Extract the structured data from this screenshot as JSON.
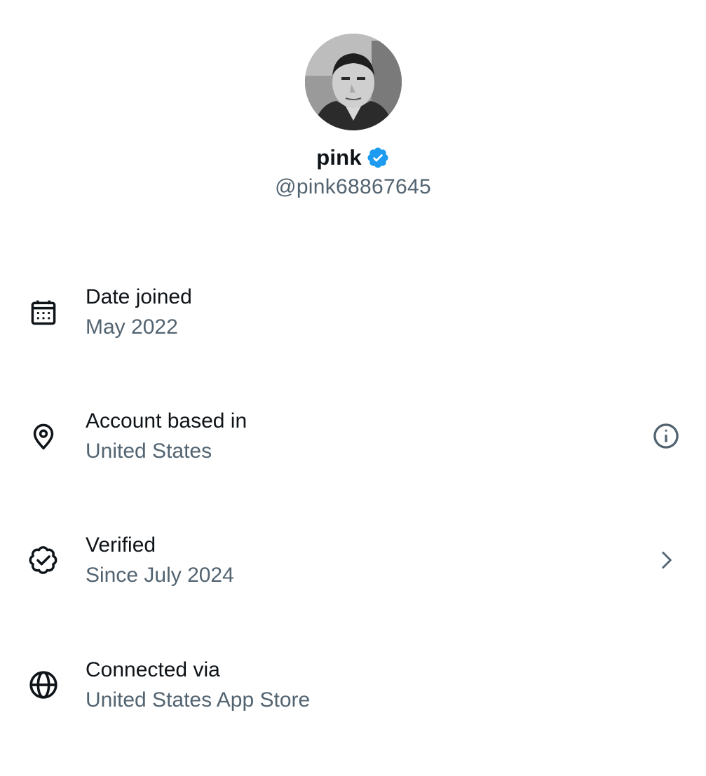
{
  "profile": {
    "display_name": "pink",
    "handle": "@pink68867645",
    "verified": true,
    "badge_color": "#1d9bf0",
    "avatar_icon": "profile-photo"
  },
  "info_rows": [
    {
      "icon": "calendar-icon",
      "title": "Date joined",
      "value": "May 2022",
      "action": ""
    },
    {
      "icon": "location-pin-icon",
      "title": "Account based in",
      "value": "United States",
      "action": "info-icon"
    },
    {
      "icon": "verified-badge-icon",
      "title": "Verified",
      "value": "Since July 2024",
      "action": "chevron-right-icon"
    },
    {
      "icon": "globe-icon",
      "title": "Connected via",
      "value": "United States App Store",
      "action": ""
    }
  ],
  "colors": {
    "text_primary": "#0f1419",
    "text_secondary": "#536471",
    "background": "#ffffff"
  }
}
